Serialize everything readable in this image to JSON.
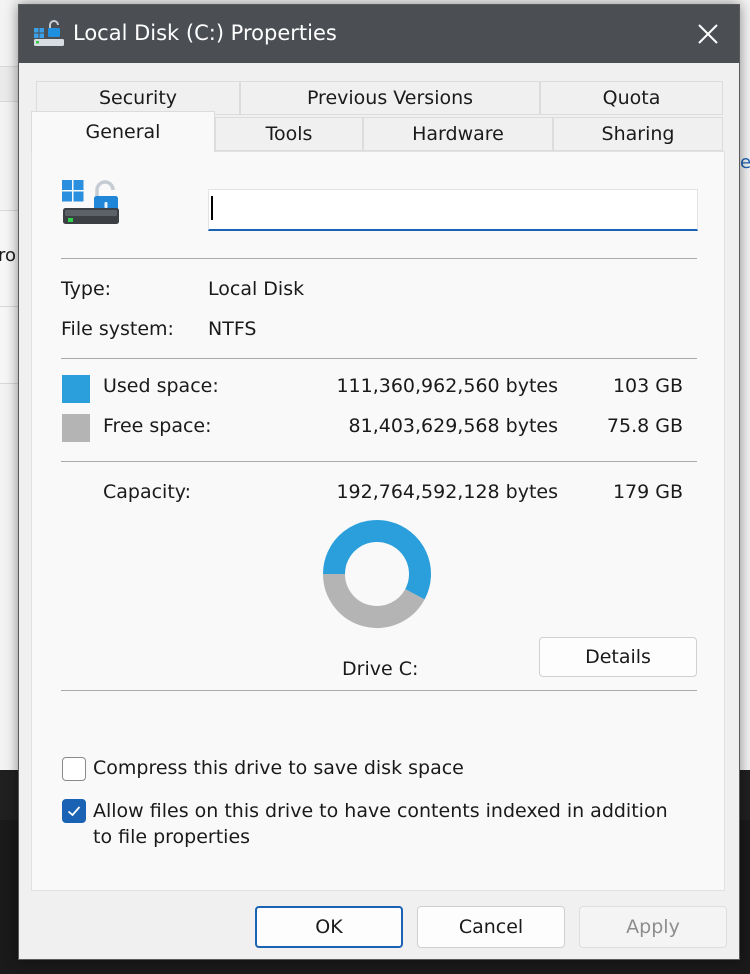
{
  "background": {
    "left_fragment_text": "ro",
    "right_fragment_text": "e"
  },
  "window": {
    "title": "Local Disk (C:) Properties",
    "icon": "drive-lock-icon",
    "close_icon": "close-icon"
  },
  "tabs": {
    "row1": [
      "Security",
      "Previous Versions",
      "Quota"
    ],
    "row2": [
      "General",
      "Tools",
      "Hardware",
      "Sharing"
    ],
    "active": "General"
  },
  "general": {
    "drive_name_value": "",
    "type_label": "Type:",
    "type_value": "Local Disk",
    "fs_label": "File system:",
    "fs_value": "NTFS",
    "used_label": "Used space:",
    "used_bytes": "111,360,962,560 bytes",
    "used_size": "103 GB",
    "free_label": "Free space:",
    "free_bytes": "81,403,629,568 bytes",
    "free_size": "75.8 GB",
    "capacity_label": "Capacity:",
    "capacity_bytes": "192,764,592,128 bytes",
    "capacity_size": "179 GB",
    "drive_label": "Drive C:",
    "details_label": "Details",
    "used_fraction": 0.578,
    "used_color": "#2b9fdb",
    "free_color": "#b4b4b4"
  },
  "options": {
    "compress_label": "Compress this drive to save disk space",
    "compress_checked": false,
    "index_label_line1": "Allow files on this drive to have contents indexed in addition",
    "index_label_line2": "to file properties",
    "index_checked": true
  },
  "buttons": {
    "ok": "OK",
    "cancel": "Cancel",
    "apply": "Apply"
  },
  "colors": {
    "accent": "#1a62b3",
    "titlebar": "#4b4f54"
  }
}
